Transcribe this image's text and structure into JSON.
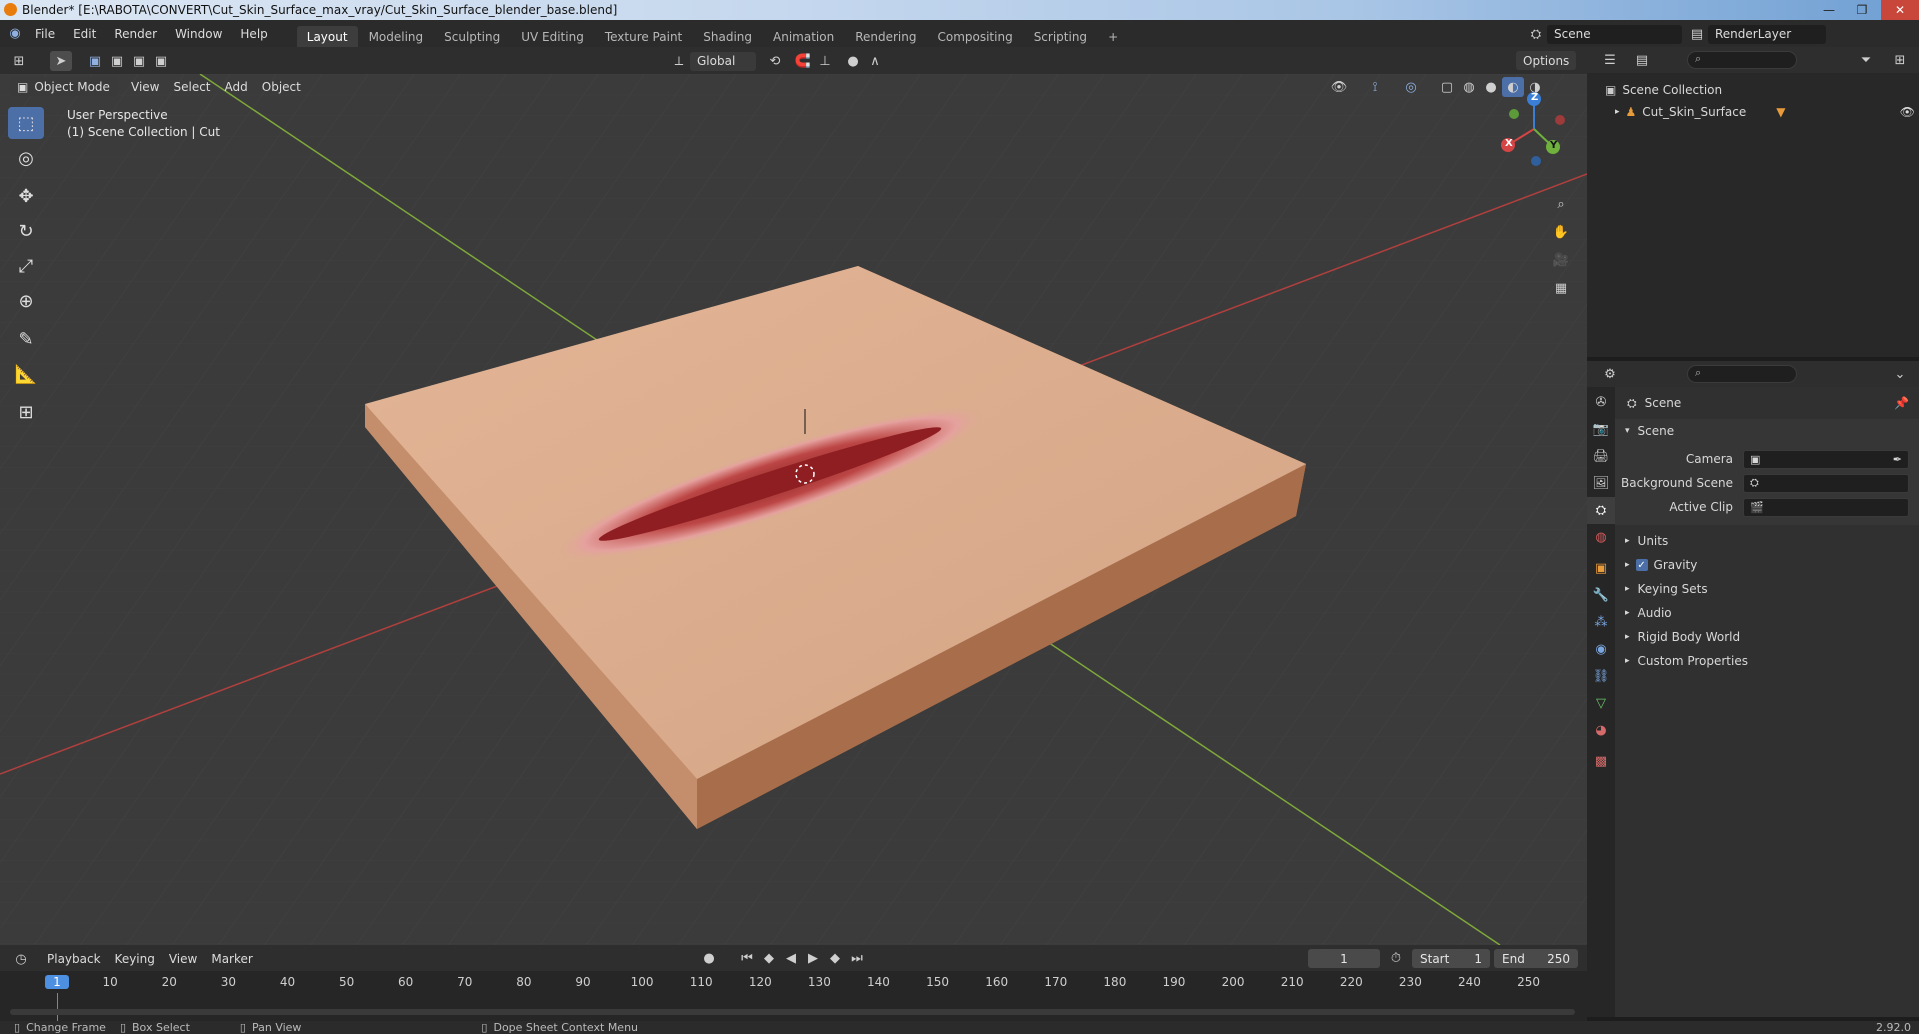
{
  "window": {
    "title": "Blender* [E:\\RABOTA\\CONVERT\\Cut_Skin_Surface_max_vray/Cut_Skin_Surface_blender_base.blend]",
    "scene_name": "Scene",
    "render_layer": "RenderLayer"
  },
  "menu": [
    "File",
    "Edit",
    "Render",
    "Window",
    "Help"
  ],
  "workspaces": [
    "Layout",
    "Modeling",
    "Sculpting",
    "UV Editing",
    "Texture Paint",
    "Shading",
    "Animation",
    "Rendering",
    "Compositing",
    "Scripting"
  ],
  "active_workspace": "Layout",
  "viewport_header": {
    "transform_orientation": "Global",
    "options_label": "Options",
    "mode": "Object Mode",
    "menus": [
      "View",
      "Select",
      "Add",
      "Object"
    ]
  },
  "viewport_overlay": {
    "perspective": "User Perspective",
    "collection": "(1) Scene Collection | Cut"
  },
  "gizmo_axes": {
    "x": "X",
    "y": "Y",
    "z": "Z"
  },
  "outliner": {
    "root": "Scene Collection",
    "items": [
      {
        "label": "Cut_Skin_Surface"
      }
    ]
  },
  "properties": {
    "context": "Scene",
    "panel_title": "Scene",
    "fields": [
      {
        "label": "Camera"
      },
      {
        "label": "Background Scene"
      },
      {
        "label": "Active Clip"
      }
    ],
    "sections": [
      {
        "label": "Units"
      },
      {
        "label": "Gravity",
        "checked": true
      },
      {
        "label": "Keying Sets"
      },
      {
        "label": "Audio"
      },
      {
        "label": "Rigid Body World"
      },
      {
        "label": "Custom Properties"
      }
    ]
  },
  "timeline": {
    "menus": [
      "Playback",
      "Keying",
      "View",
      "Marker"
    ],
    "current_frame": "1",
    "start_label": "Start",
    "start": "1",
    "end_label": "End",
    "end": "250",
    "ticks": [
      "1",
      "10",
      "20",
      "30",
      "40",
      "50",
      "60",
      "70",
      "80",
      "90",
      "100",
      "110",
      "120",
      "130",
      "140",
      "150",
      "160",
      "170",
      "180",
      "190",
      "200",
      "210",
      "220",
      "230",
      "240",
      "250"
    ]
  },
  "statusbar": {
    "items": [
      "Change Frame",
      "Box Select",
      "Pan View",
      "Dope Sheet Context Menu"
    ],
    "version": "2.92.0"
  },
  "colors": {
    "accent": "#4d6fa8",
    "grid_red": "#b0403e",
    "grid_green": "#7ea83a",
    "skin": "#dcae8a"
  }
}
